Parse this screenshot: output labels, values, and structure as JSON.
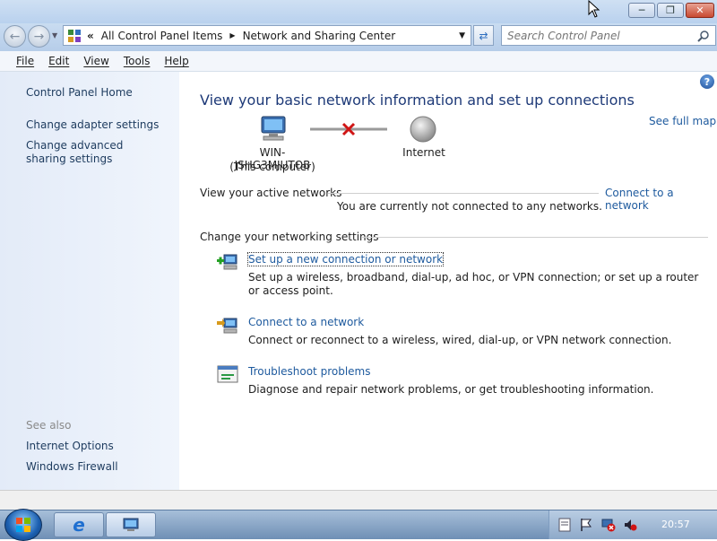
{
  "address": {
    "crumbs": [
      "All Control Panel Items",
      "Network and Sharing Center"
    ],
    "overflow": "«"
  },
  "search": {
    "placeholder": "Search Control Panel"
  },
  "menu": [
    "File",
    "Edit",
    "View",
    "Tools",
    "Help"
  ],
  "left_pane": {
    "home": "Control Panel Home",
    "links": [
      "Change adapter settings",
      "Change advanced sharing settings"
    ],
    "see_also_label": "See also",
    "see_also": [
      "Internet Options",
      "Windows Firewall"
    ]
  },
  "main": {
    "title": "View your basic network information and set up connections",
    "see_full_map": "See full map",
    "computer_name": "WIN-JSHG3MJUTOB",
    "computer_sub": "(This computer)",
    "internet_label": "Internet",
    "active_networks": {
      "label": "View your active networks",
      "connect_link": "Connect to a network",
      "status": "You are currently not connected to any networks."
    },
    "change_settings_label": "Change your networking settings",
    "tasks": [
      {
        "title": "Set up a new connection or network",
        "desc": "Set up a wireless, broadband, dial-up, ad hoc, or VPN connection; or set up a router or access point."
      },
      {
        "title": "Connect to a network",
        "desc": "Connect or reconnect to a wireless, wired, dial-up, or VPN network connection."
      },
      {
        "title": "Troubleshoot problems",
        "desc": "Diagnose and repair network problems, or get troubleshooting information."
      }
    ]
  },
  "taskbar": {
    "clock": "20:57"
  },
  "colors": {
    "link": "#1e5a9e",
    "title": "#1e3a78",
    "error_x": "#d01515"
  }
}
